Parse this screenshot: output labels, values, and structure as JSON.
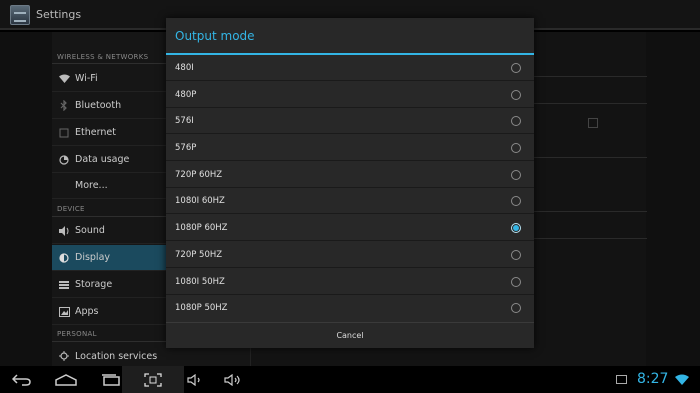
{
  "app": {
    "title": "Settings",
    "icon": "settings-icon"
  },
  "sidebar": {
    "sections": [
      {
        "header": "WIRELESS & NETWORKS"
      },
      {
        "header": "DEVICE"
      },
      {
        "header": "PERSONAL"
      }
    ],
    "items": [
      {
        "label": "Wi-Fi",
        "icon": "wifi-icon"
      },
      {
        "label": "Bluetooth",
        "icon": "bluetooth-icon"
      },
      {
        "label": "Ethernet",
        "icon": "ethernet-icon"
      },
      {
        "label": "Data usage",
        "icon": "data-usage-icon"
      },
      {
        "label": "More...",
        "icon": ""
      },
      {
        "label": "Sound",
        "icon": "sound-icon"
      },
      {
        "label": "Display",
        "icon": "display-icon",
        "selected": true
      },
      {
        "label": "Storage",
        "icon": "storage-icon"
      },
      {
        "label": "Apps",
        "icon": "apps-icon"
      },
      {
        "label": "Location services",
        "icon": "location-icon"
      }
    ]
  },
  "dialog": {
    "title": "Output mode",
    "options": [
      {
        "label": "480I",
        "selected": false
      },
      {
        "label": "480P",
        "selected": false
      },
      {
        "label": "576I",
        "selected": false
      },
      {
        "label": "576P",
        "selected": false
      },
      {
        "label": "720P 60HZ",
        "selected": false
      },
      {
        "label": "1080I 60HZ",
        "selected": false
      },
      {
        "label": "1080P 60HZ",
        "selected": true
      },
      {
        "label": "720P 50HZ",
        "selected": false
      },
      {
        "label": "1080I 50HZ",
        "selected": false
      },
      {
        "label": "1080P 50HZ",
        "selected": false
      }
    ],
    "cancel_label": "Cancel"
  },
  "navbar": {
    "buttons": [
      "back-icon",
      "home-icon",
      "recent-apps-icon",
      "screenshot-icon",
      "volume-down-icon",
      "volume-up-icon"
    ],
    "clock": "8:27"
  },
  "colors": {
    "accent": "#33b5e5",
    "selected_item": "#1b4a5e",
    "dialog_bg": "#282828"
  }
}
